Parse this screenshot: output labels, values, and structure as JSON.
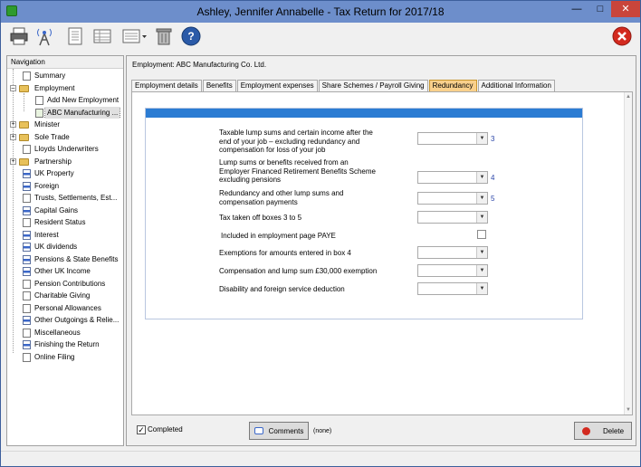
{
  "window": {
    "title": "Ashley, Jennifer Annabelle - Tax Return for 2017/18"
  },
  "toolbar": {
    "buttons": [
      "printer-icon",
      "broadcast-icon",
      "document-icon",
      "table-icon",
      "menu-icon",
      "trash-icon",
      "help-icon",
      "close-icon"
    ]
  },
  "navigation": {
    "header": "Navigation",
    "items": [
      {
        "label": "Summary"
      },
      {
        "label": "Employment"
      },
      {
        "label": "Add New Employment"
      },
      {
        "label": "ABC Manufacturing ..."
      },
      {
        "label": "Minister"
      },
      {
        "label": "Sole Trade"
      },
      {
        "label": "Lloyds Underwriters"
      },
      {
        "label": "Partnership"
      },
      {
        "label": "UK Property"
      },
      {
        "label": "Foreign"
      },
      {
        "label": "Trusts, Settlements, Est..."
      },
      {
        "label": "Capital Gains"
      },
      {
        "label": "Resident Status"
      },
      {
        "label": "Interest"
      },
      {
        "label": "UK dividends"
      },
      {
        "label": "Pensions & State Benefits"
      },
      {
        "label": "Other UK Income"
      },
      {
        "label": "Pension Contributions"
      },
      {
        "label": "Charitable Giving"
      },
      {
        "label": "Personal Allowances"
      },
      {
        "label": "Other Outgoings & Relie..."
      },
      {
        "label": "Miscellaneous"
      },
      {
        "label": "Finishing the Return"
      },
      {
        "label": "Online Filing"
      }
    ]
  },
  "main": {
    "employment_title": "Employment: ABC Manufacturing Co. Ltd.",
    "tabs": [
      {
        "label": "Employment details"
      },
      {
        "label": "Benefits"
      },
      {
        "label": "Employment expenses"
      },
      {
        "label": "Share Schemes / Payroll Giving"
      },
      {
        "label": "Redundancy"
      },
      {
        "label": "Additional Information"
      }
    ],
    "form": {
      "q1_l1": "Taxable lump sums and certain income after the",
      "q1_l2": "end of your job – excluding redundancy and",
      "q1_l3": "compensation for loss of your job",
      "q1_box": "3",
      "q2_l1": "Lump sums or benefits received from an",
      "q2_l2": "Employer Financed Retirement Benefits Scheme",
      "q2_l3": "excluding pensions",
      "q2_box": "4",
      "q3_l1": "Redundancy and other lump sums and",
      "q3_l2": "compensation payments",
      "q3_box": "5",
      "q4": "Tax taken off boxes 3 to 5",
      "q5": "Included in employment page PAYE",
      "q6": "Exemptions for amounts entered in box 4",
      "q7": "Compensation and lump sum £30,000 exemption",
      "q8": "Disability and foreign service deduction"
    }
  },
  "bottom": {
    "completed_label": "Completed",
    "comments_label": "Comments",
    "none_label": "(none)",
    "delete_label": "Delete"
  }
}
